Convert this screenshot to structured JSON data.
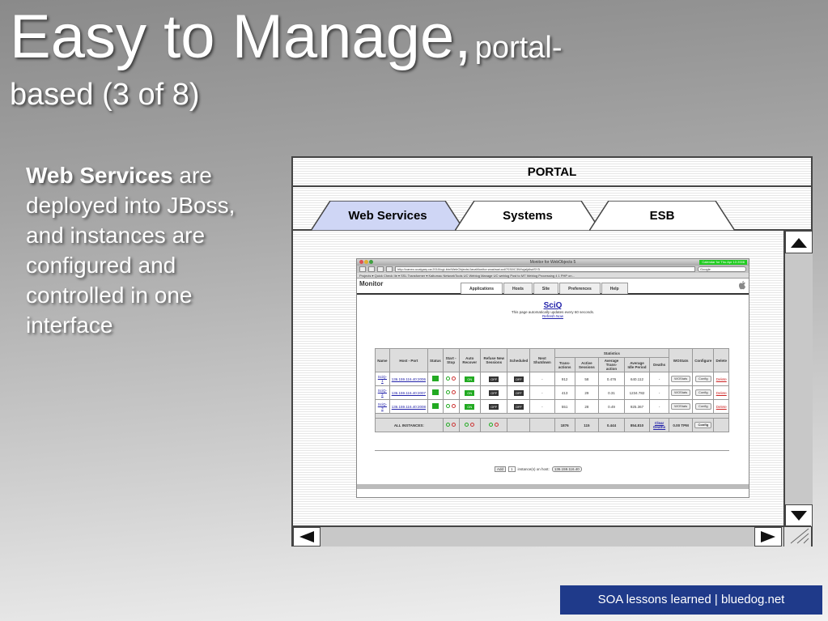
{
  "slide": {
    "title_main": "Easy to Manage,",
    "title_small": "portal-",
    "title_line2": "based (3 of 8)",
    "bullet_bold": "Web Services",
    "bullet_rest": " are deployed into JBoss, and instances are configured and controlled in one interface",
    "footer": "SOA lessons learned | bluedog.net"
  },
  "portal": {
    "title": "PORTAL",
    "tabs": [
      {
        "label": "Web Services",
        "selected": true
      },
      {
        "label": "Systems",
        "selected": false
      },
      {
        "label": "ESB",
        "selected": false
      }
    ],
    "colors": {
      "selected_tab": "#cfd6f5",
      "tab": "#ffffff",
      "scroll": "#c8c8c8"
    }
  },
  "browser": {
    "window_title": "Monitor for WebObjects 5",
    "badge": "Calendar for Thu Apr 13 2006",
    "url": "http://caneo.ucalgary.ca:2010/cgi-bin/WebObjects/JavaMonitor.woa/wa/ucd/7030/C3W/ujaljdlsdSY5",
    "search_placeholder": "Google",
    "bookmarks": "Projects ▾  Quick Check IIe ▾  SSL Transformer ▾  Kalturnac  NetworkTools  UC Weblog  Manage UC weblog  Post to MT Weblog  Processing 4  1 PHP on...",
    "monitor_title": "Monitor",
    "monitor_tabs": [
      "Applications",
      "Hosts",
      "Site",
      "Preferences",
      "Help"
    ],
    "app_name": "SciQ",
    "auto_update": "This page automatically updates every 60 seconds.",
    "refresh": "Refresh Now",
    "columns": [
      "Name",
      "Host - Port",
      "Status",
      "Start - Stop",
      "Auto Recover",
      "Refuse New Sessions",
      "Scheduled",
      "Next Shutdown",
      "Trans-actions",
      "Active Sessions",
      "Average Trans-action",
      "Average Idle Period",
      "Deaths",
      "WOStats",
      "Configure",
      "Delete"
    ],
    "statistics_label": "Statistics",
    "rows": [
      {
        "name": "SciQ-1",
        "host": "136.159.116.40:2006",
        "next": "-",
        "trans": "912",
        "active": "58",
        "avg": "0.476",
        "idle": "640.112",
        "deaths": "-",
        "wostats": "WOStats",
        "config": "Config",
        "delete": "Delete",
        "auto": "ON",
        "refuse": "OFF",
        "sched": "OFF"
      },
      {
        "name": "SciQ-2",
        "host": "136.159.116.40:2007",
        "next": "-",
        "trans": "413",
        "active": "29",
        "avg": "0.31",
        "idle": "1234.782",
        "deaths": "-",
        "wostats": "WOStats",
        "config": "Config",
        "delete": "Delete",
        "auto": "ON",
        "refuse": "OFF",
        "sched": "OFF"
      },
      {
        "name": "SciQ-3",
        "host": "136.159.116.40:2008",
        "next": "-",
        "trans": "551",
        "active": "28",
        "avg": "0.49",
        "idle": "925.367",
        "deaths": "-",
        "wostats": "WOStats",
        "config": "Config",
        "delete": "Delete",
        "auto": "ON",
        "refuse": "OFF",
        "sched": "OFF"
      }
    ],
    "all_instances": {
      "label": "ALL INSTANCES:",
      "trans": "1876",
      "active": "115",
      "avg": "0.444",
      "idle": "854.810",
      "deaths": "Clear Deaths",
      "wostats": "0.00 TPM",
      "config": "Config"
    },
    "add_button": "Add",
    "add_count": "1",
    "add_text": "instance(s) on host:",
    "add_host": "136.159.116.40"
  }
}
